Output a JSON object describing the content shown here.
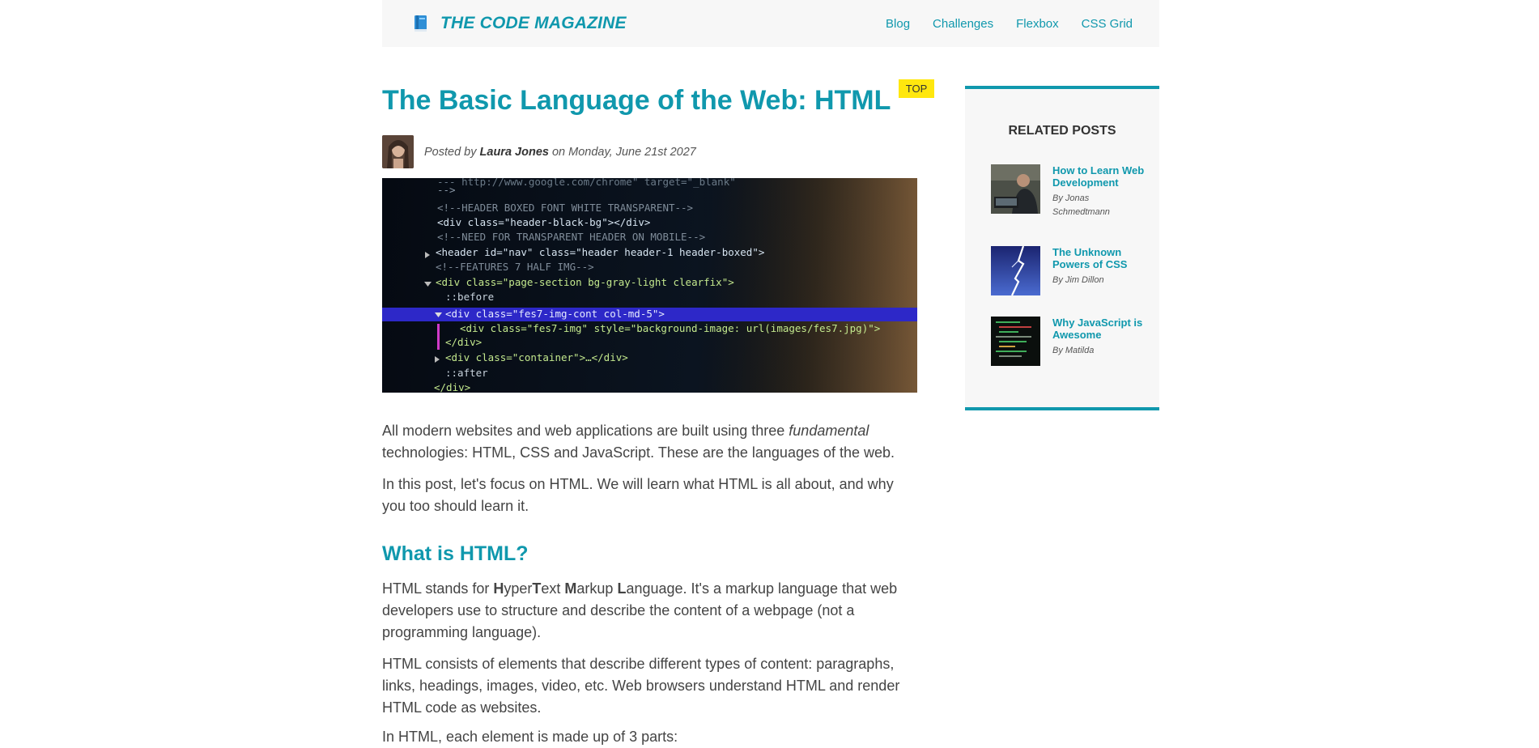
{
  "header": {
    "brand": "THE CODE MAGAZINE",
    "brand_icon": "book-icon",
    "nav": [
      "Blog",
      "Challenges",
      "Flexbox",
      "CSS Grid"
    ]
  },
  "article": {
    "badge": "TOP",
    "title": "The Basic Language of the Web: HTML",
    "byline": {
      "prefix": "Posted by",
      "author": "Laura Jones",
      "date": "on Monday, June 21st 2027"
    },
    "hero_code_lines": [
      "--- http://www.google.com/chrome\" target=\"_blank\"",
      "-->",
      "<!--HEADER BOXED FONT WHITE TRANSPARENT-->",
      "<div class=\"header-black-bg\"></div>",
      "<!--NEED FOR TRANSPARENT HEADER ON MOBILE-->",
      "<header id=\"nav\" class=\"header header-1 header-boxed\">",
      "<!--FEATURES 7 HALF IMG-->",
      "<div class=\"page-section bg-gray-light clearfix\">",
      "::before",
      "<div class=\"fes7-img-cont col-md-5\">",
      "<div class=\"fes7-img\" style=\"background-image: url(images/fes7.jpg)\">",
      "</div>",
      "<div class=\"container\">…</div>",
      "::after",
      "</div>"
    ],
    "p1": {
      "before": "All modern websites and web applications are built using three ",
      "emphasis": "fundamental",
      "after": " technologies: HTML, CSS and JavaScript. These are the languages of the web."
    },
    "p2": "In this post, let's focus on HTML. We will learn what HTML is all about, and why you too should learn it.",
    "h2": "What is HTML?",
    "p3": {
      "t1": "HTML stands for ",
      "b1": "H",
      "t2": "yper",
      "b2": "T",
      "t3": "ext ",
      "b3": "M",
      "t4": "arkup ",
      "b4": "L",
      "t5": "anguage. It's a markup language that web developers use to structure and describe the content of a webpage (not a programming language)."
    },
    "p4": "HTML consists of elements that describe different types of content: paragraphs, links, headings, images, video, etc. Web browsers understand HTML and render HTML code as websites.",
    "p5": "In HTML, each element is made up of 3 parts:"
  },
  "sidebar": {
    "title": "RELATED POSTS",
    "posts": [
      {
        "title": "How to Learn Web Development",
        "author": "By Jonas Schmedtmann"
      },
      {
        "title": "The Unknown Powers of CSS",
        "author": "By Jim Dillon"
      },
      {
        "title": "Why JavaScript is Awesome",
        "author": "By Matilda"
      }
    ]
  },
  "colors": {
    "accent": "#1098ad",
    "badge": "#ffe70e",
    "panel": "#f7f7f7",
    "text": "#444444"
  }
}
